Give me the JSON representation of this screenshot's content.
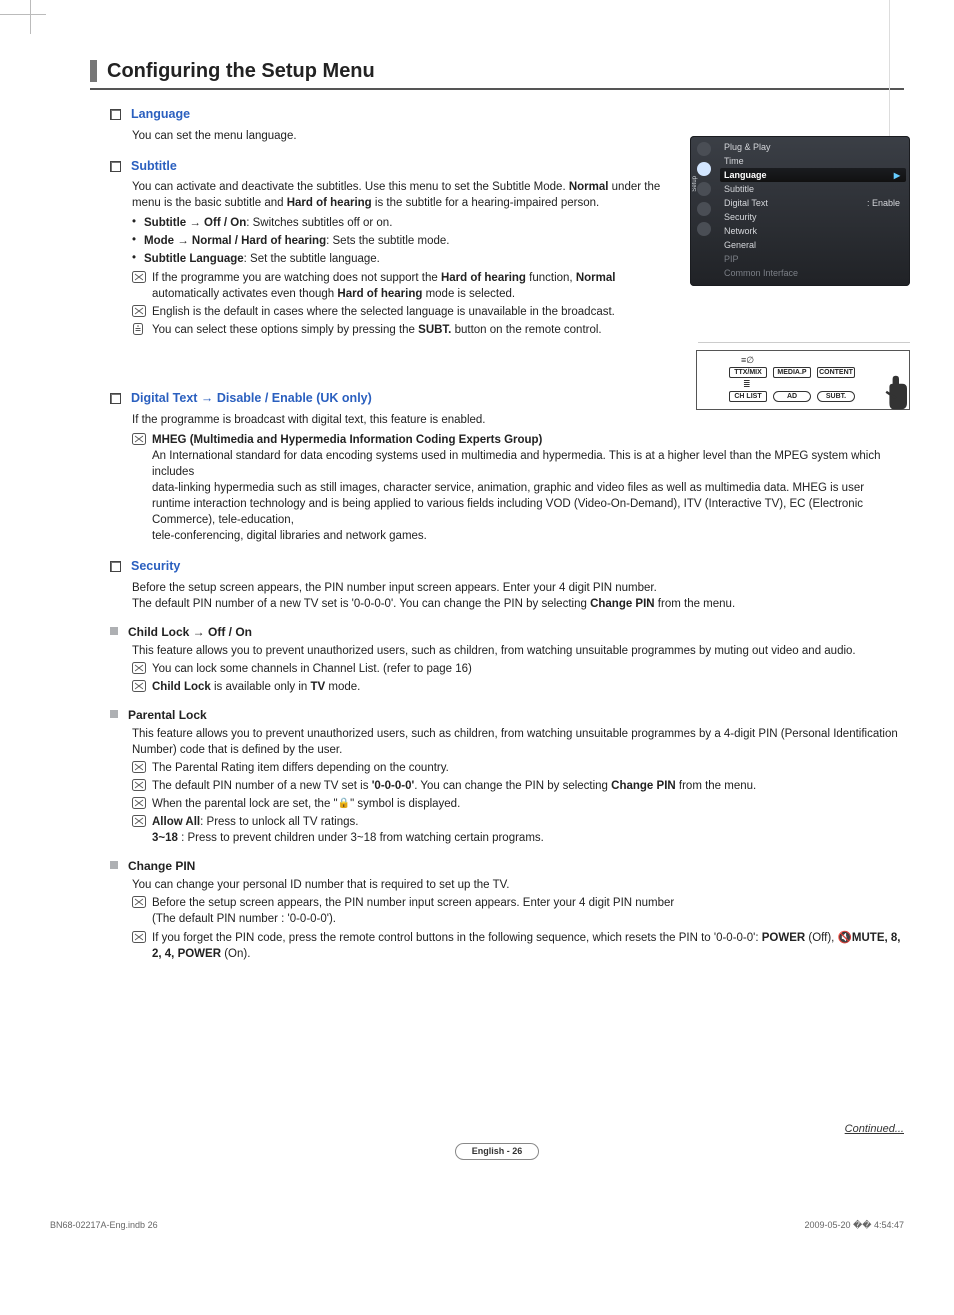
{
  "pageTitle": "Configuring the Setup Menu",
  "language": {
    "heading": "Language",
    "text": "You can set the menu language."
  },
  "subtitle": {
    "heading": "Subtitle",
    "intro_pre": "You can activate and deactivate the subtitles. Use this menu to set the Subtitle Mode. ",
    "intro_bold1": "Normal",
    "intro_mid": " under the menu is the basic subtitle and ",
    "intro_bold2": "Hard of hearing",
    "intro_post": " is the subtitle for a hearing-impaired person.",
    "b1_b": "Subtitle → Off / On",
    "b1_t": ": Switches subtitles off or on.",
    "b2_b": "Mode → Normal / Hard of hearing",
    "b2_t": ": Sets the subtitle mode.",
    "b3_b": "Subtitle Language",
    "b3_t": ": Set the subtitle language.",
    "n1_pre": "If the programme you are watching does not support the ",
    "n1_b1": "Hard of hearing",
    "n1_mid": " function, ",
    "n1_b2": "Normal",
    "n1_post1": " automatically activates even though ",
    "n1_b3": "Hard of hearing",
    "n1_post2": " mode is selected.",
    "n2": "English is the default in cases where the selected language is unavailable in the broadcast.",
    "n3_pre": "You can select these options simply by pressing the ",
    "n3_b": "SUBT.",
    "n3_post": " button on the remote control."
  },
  "digitalText": {
    "heading": "Digital Text → Disable / Enable (UK only)",
    "text": "If the programme is broadcast with digital text, this feature is enabled.",
    "mheg_title": "MHEG (Multimedia and Hypermedia Information Coding Experts Group)",
    "mheg_p1": "An International standard for data encoding systems used in multimedia and hypermedia. This is at a higher level than the MPEG system which includes",
    "mheg_p2": "data-linking hypermedia such as still images, character service, animation, graphic and video files as well as multimedia data. MHEG is user runtime interaction technology and is being applied to various fields including VOD (Video-On-Demand), ITV (Interactive TV), EC (Electronic Commerce), tele-education,",
    "mheg_p3": "tele-conferencing, digital libraries and network games."
  },
  "security": {
    "heading": "Security",
    "p1": "Before the setup screen appears, the PIN number input screen appears. Enter your 4 digit PIN number.",
    "p2_pre": "The default PIN number of a new TV set is '0-0-0-0'. You can change the PIN by selecting ",
    "p2_b": "Change PIN",
    "p2_post": " from the menu."
  },
  "childLock": {
    "heading": "Child Lock → Off / On",
    "text": "This feature allows you to prevent unauthorized users, such as children, from watching unsuitable programmes by muting out video and audio.",
    "n1": "You can lock some channels in Channel List. (refer to page 16)",
    "n2_b": "Child Lock",
    "n2_mid": " is available only in ",
    "n2_b2": "TV",
    "n2_post": " mode."
  },
  "parentalLock": {
    "heading": "Parental Lock",
    "text": "This feature allows you to prevent unauthorized users, such as children, from watching unsuitable programmes by a 4-digit PIN (Personal Identification Number) code that is defined by the user.",
    "n1": "The Parental Rating item differs depending on the country.",
    "n2_pre": "The default PIN number of a new TV set is ",
    "n2_b1": "'0-0-0-0'",
    "n2_mid": ". You can change the PIN by selecting ",
    "n2_b2": "Change PIN",
    "n2_post": " from the menu.",
    "n3_pre": "When the parental lock are set, the \"",
    "n3_post": "\" symbol is displayed.",
    "n4_b": "Allow All",
    "n4_t": ": Press to unlock all TV ratings.",
    "n4_line2_b": "3~18",
    "n4_line2_t": " : Press to prevent children under 3~18 from watching certain programs."
  },
  "changePin": {
    "heading": "Change PIN",
    "text": "You can change your personal ID number that is required to set up the TV.",
    "n1_l1": "Before the setup screen appears, the PIN number input screen appears. Enter your 4 digit PIN number",
    "n1_l2": "(The default PIN number : '0-0-0-0').",
    "n2_pre": "If you forget the PIN code, press the remote control buttons in the following sequence, which resets the PIN to '0-0-0-0': ",
    "n2_b1": "POWER",
    "n2_t1": " (Off), ",
    "n2_b2": "MUTE, 8, 2, 4, POWER",
    "n2_t2": " (On)."
  },
  "osd": {
    "items": [
      "Plug & Play",
      "Time",
      "Language",
      "Subtitle",
      "Digital Text",
      "Security",
      "Network",
      "General",
      "PIP",
      "Common Interface"
    ],
    "selectedIndex": 2,
    "digitalTextValue": ": Enable",
    "sideLabel": "Setup"
  },
  "remote": {
    "buttons": [
      "TTX/MIX",
      "MEDIA.P",
      "CONTENT",
      "CH LIST",
      "AD",
      "SUBT."
    ]
  },
  "continued": "Continued...",
  "pagePill": "English - 26",
  "footer": {
    "left": "BN68-02217A-Eng.indb   26",
    "right": "2009-05-20   �� 4:54:47"
  }
}
